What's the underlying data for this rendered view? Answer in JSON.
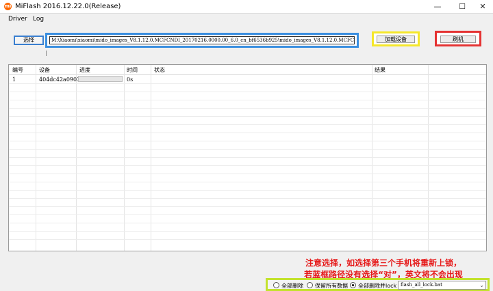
{
  "window": {
    "title": "MiFlash 2016.12.22.0(Release)",
    "app_icon_text": "mi",
    "minimize_glyph": "—",
    "maximize_glyph": "☐",
    "close_glyph": "✕"
  },
  "menu": {
    "driver": "Driver",
    "log": "Log"
  },
  "toolbar": {
    "select_label": "选择",
    "path_value": "M:\\Xiaomi\\xiaomi\\mido_images_V8.1.12.0.MCFCNDI_20170216.0000.00_6.0_cn_bf6536b925\\mido_images_V8.1.12.0.MCFCNDI_2017",
    "load_device_label": "加载设备",
    "flash_label": "刷机"
  },
  "grid": {
    "columns": [
      "编号",
      "设备",
      "进度",
      "时间",
      "状态",
      "结果"
    ],
    "rows": [
      {
        "id": "1",
        "device": "404dc42a0903",
        "progress": 0,
        "time": "0s",
        "status": "",
        "result": ""
      }
    ]
  },
  "annotation": {
    "line1": "注意选择，如选择第三个手机将重新上锁，",
    "line2": "若蓝框路径没有选择“对”，英文将不会出现"
  },
  "options": {
    "clean_all": "全部删除",
    "save_user_data": "保留所有数据",
    "clean_all_and_lock": "全部删除并lock",
    "selected": "clean_all_and_lock",
    "script_value": "flash_all_lock.bat"
  },
  "colors": {
    "path_highlight": "#3a8fe0",
    "load_highlight": "#f5e72a",
    "flash_highlight": "#e53333",
    "options_highlight": "#c3e22e",
    "annotation_text": "#e61a1a"
  }
}
